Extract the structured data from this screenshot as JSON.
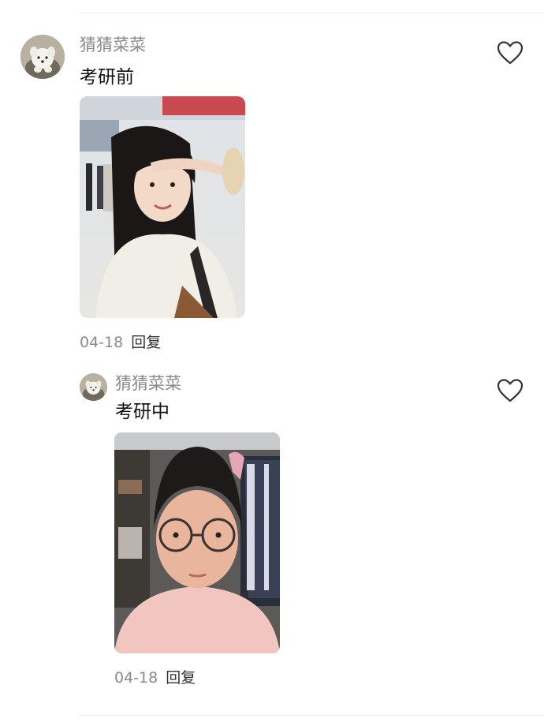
{
  "comments": [
    {
      "username": "猜猜菜菜",
      "text": "考研前",
      "date": "04-18",
      "reply_label": "回复"
    },
    {
      "username": "猜猜菜菜",
      "text": "考研中",
      "date": "04-18",
      "reply_label": "回复"
    }
  ],
  "icons": {
    "like": "heart-outline-icon",
    "avatar": "white-puppy-avatar"
  },
  "colors": {
    "username": "#8a8a8a",
    "text": "#111111",
    "divider": "#ececec",
    "like_stroke": "#333333"
  }
}
